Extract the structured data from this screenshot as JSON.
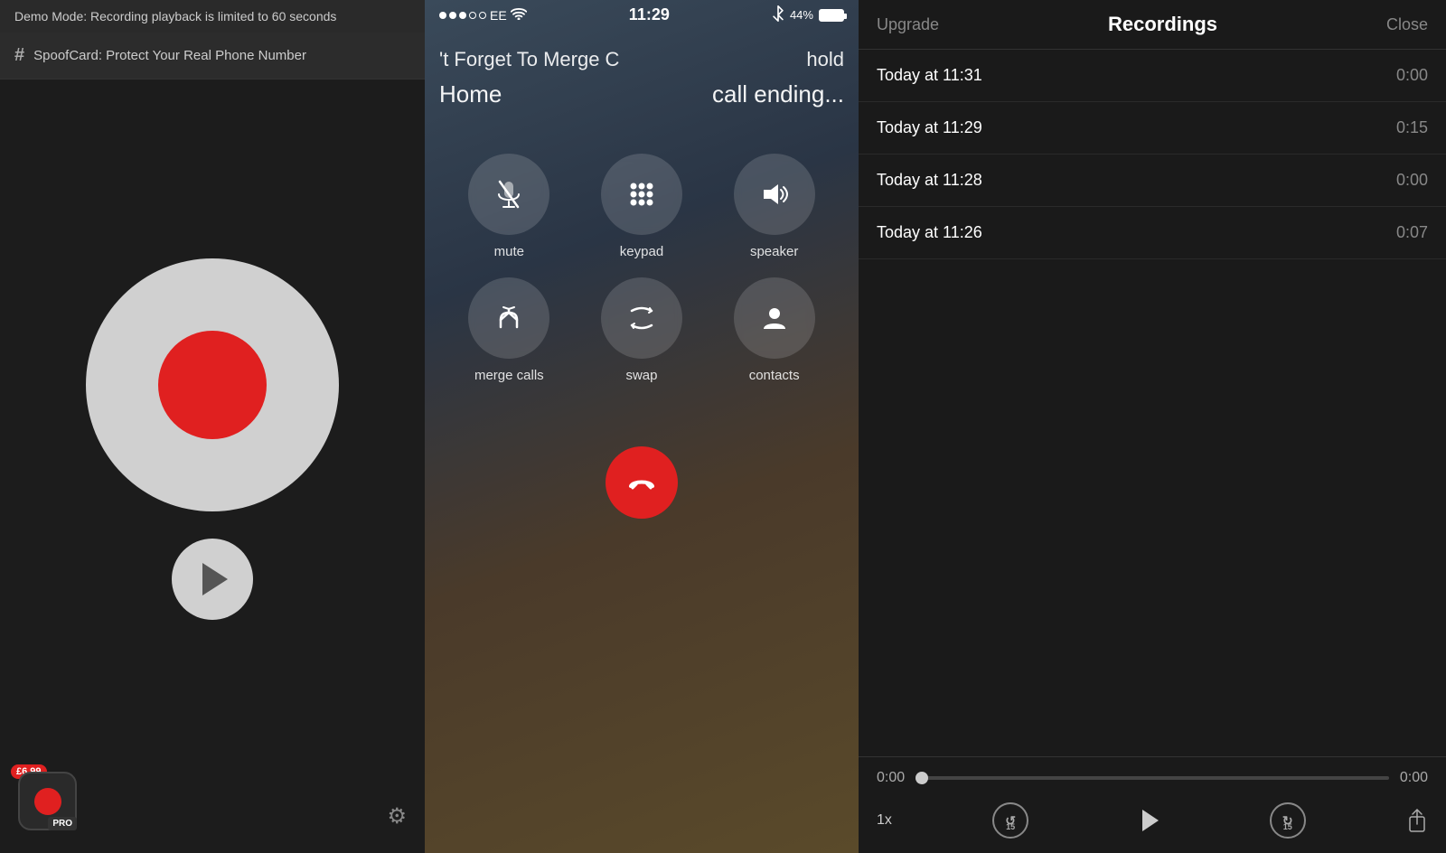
{
  "left": {
    "demo_banner": "Demo Mode: Recording playback is limited to 60 seconds",
    "spoofcard_text": "SpoofCard: Protect Your Real Phone Number",
    "hash_icon": "#",
    "price": "£6.99",
    "pro_label": "PRO",
    "gear_icon": "⚙"
  },
  "middle": {
    "status": {
      "carrier": "EE",
      "time": "11:29",
      "battery": "44%"
    },
    "call_top_left": "'t Forget To Merge C",
    "call_top_right": "hold",
    "call_bottom_left": "Home",
    "call_bottom_right": "call ending...",
    "controls": [
      {
        "id": "mute",
        "label": "mute"
      },
      {
        "id": "keypad",
        "label": "keypad"
      },
      {
        "id": "speaker",
        "label": "speaker"
      },
      {
        "id": "merge-calls",
        "label": "merge calls"
      },
      {
        "id": "swap",
        "label": "swap"
      },
      {
        "id": "contacts",
        "label": "contacts"
      }
    ]
  },
  "right": {
    "header": {
      "upgrade": "Upgrade",
      "title": "Recordings",
      "close": "Close"
    },
    "recordings": [
      {
        "time": "Today at 11:31",
        "duration": "0:00"
      },
      {
        "time": "Today at 11:29",
        "duration": "0:15"
      },
      {
        "time": "Today at 11:28",
        "duration": "0:00"
      },
      {
        "time": "Today at 11:26",
        "duration": "0:07"
      }
    ],
    "player": {
      "current_time": "0:00",
      "total_time": "0:00",
      "speed": "1x",
      "skip_back": "15",
      "skip_fwd": "15"
    }
  }
}
